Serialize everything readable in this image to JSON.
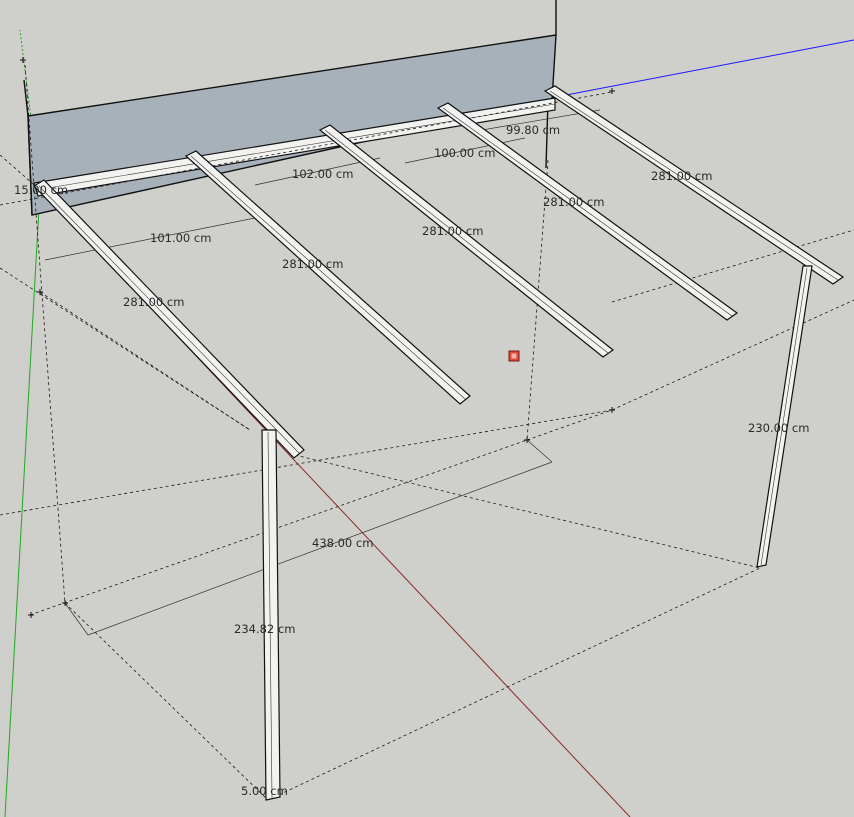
{
  "app": {
    "name": "3D modeling viewport"
  },
  "colors": {
    "background": "#cfcfcb",
    "wall": "#a6b1b9",
    "axis_red": "#8a2a2a",
    "axis_green": "#22aa22",
    "axis_blue": "#1a1aff",
    "beam_fill": "#f2f2f0",
    "marker": "#d94c3a"
  },
  "dimensions": {
    "left_small": "15.00 cm",
    "spacing_1": "101.00 cm",
    "spacing_2": "102.00 cm",
    "spacing_3": "100.00 cm",
    "spacing_4": "99.80 cm",
    "rafter_1": "281.00 cm",
    "rafter_2": "281.00 cm",
    "rafter_3": "281.00 cm",
    "rafter_4": "281.00 cm",
    "rafter_5": "281.00 cm",
    "span": "438.00 cm",
    "post_front": "234.82 cm",
    "post_back": "230.00 cm",
    "post_width": "5.00 cm"
  },
  "icons": {
    "inference_marker": "selection-marker-icon"
  }
}
